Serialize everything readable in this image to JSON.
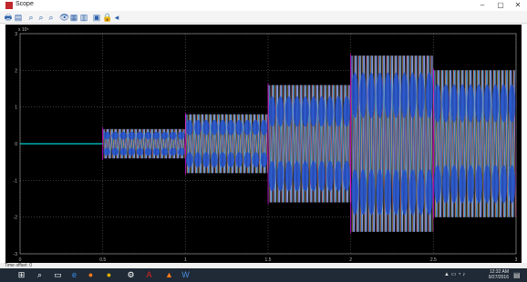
{
  "window": {
    "title": "Scope"
  },
  "window_controls": {
    "minimize": "–",
    "maximize": "▢",
    "close": "✕"
  },
  "toolbar": {
    "items": [
      {
        "name": "print-icon",
        "glyph": "🖶"
      },
      {
        "name": "params-icon",
        "glyph": "▤"
      },
      {
        "name": "zoom-icon",
        "glyph": "⌕"
      },
      {
        "name": "zoom-x-icon",
        "glyph": "⌕"
      },
      {
        "name": "zoom-y-icon",
        "glyph": "⌕"
      },
      {
        "name": "binoculars-icon",
        "glyph": "👁"
      },
      {
        "name": "save-axes-icon",
        "glyph": "▦"
      },
      {
        "name": "restore-axes-icon",
        "glyph": "▥"
      },
      {
        "name": "floating-scope-icon",
        "glyph": "▣"
      },
      {
        "name": "lock-icon",
        "glyph": "🔒"
      },
      {
        "name": "signal-selector-icon",
        "glyph": "◂"
      }
    ]
  },
  "status": {
    "time_offset": "Time offset:  0"
  },
  "chart_data": {
    "type": "line",
    "title": "",
    "xlabel": "",
    "ylabel": "",
    "x_ticks": [
      "0",
      "0.5",
      "1",
      "1.5",
      "2",
      "2.5",
      "3"
    ],
    "y_ticks": [
      "-3",
      "-2",
      "-1",
      "0",
      "1",
      "2",
      "3"
    ],
    "y_multiplier": "x 10⁵",
    "xlim": [
      0,
      3
    ],
    "ylim": [
      -3,
      3
    ],
    "grid": true,
    "background": "#000000",
    "segments": [
      {
        "t_start": 0,
        "t_end": 0.5,
        "amplitude": 0
      },
      {
        "t_start": 0.5,
        "t_end": 1.0,
        "amplitude": 0.4
      },
      {
        "t_start": 1.0,
        "t_end": 1.5,
        "amplitude": 0.8
      },
      {
        "t_start": 1.5,
        "t_end": 2.0,
        "amplitude": 1.6
      },
      {
        "t_start": 2.0,
        "t_end": 2.5,
        "amplitude": 2.4
      },
      {
        "t_start": 2.5,
        "t_end": 3.0,
        "amplitude": 2.0
      }
    ],
    "series_colors": [
      "#ffff00",
      "#ff00ff",
      "#00ffff",
      "#2070ff",
      "#ffffff"
    ]
  },
  "taskbar": {
    "icons": [
      {
        "name": "start-icon",
        "glyph": "⊞",
        "color": "#ffffff"
      },
      {
        "name": "search-icon",
        "glyph": "⌕",
        "color": "#ffffff"
      },
      {
        "name": "taskview-icon",
        "glyph": "▭",
        "color": "#ffffff"
      },
      {
        "name": "edge-icon",
        "glyph": "e",
        "color": "#3b8eea"
      },
      {
        "name": "firefox-icon",
        "glyph": "●",
        "color": "#ff7a1a"
      },
      {
        "name": "chrome-icon",
        "glyph": "●",
        "color": "#e0b000"
      },
      {
        "name": "settings-icon",
        "glyph": "⚙",
        "color": "#ffffff"
      },
      {
        "name": "acrobat-icon",
        "glyph": "A",
        "color": "#e02020"
      },
      {
        "name": "matlab-icon",
        "glyph": "▲",
        "color": "#ff7a1a"
      },
      {
        "name": "word-icon",
        "glyph": "W",
        "color": "#4a8ee0"
      }
    ],
    "time": "12:32 AM",
    "date": "9/27/2016",
    "tray_glyphs": "▲ ▭ ◔ ♪"
  }
}
